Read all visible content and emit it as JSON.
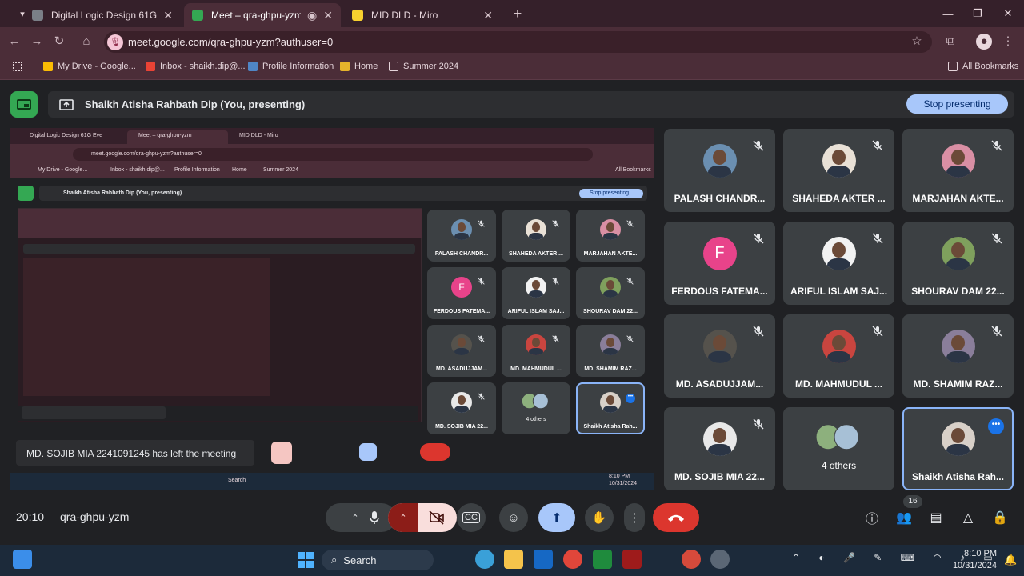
{
  "browser": {
    "tabs": [
      {
        "title": "Digital Logic Design 61G Eve",
        "color": "#7a7f87"
      },
      {
        "title": "Meet – qra-ghpu-yzm",
        "color": "#34a853"
      },
      {
        "title": "MID DLD - Miro",
        "color": "#f8d12f"
      }
    ],
    "new_tab": "+",
    "url": "meet.google.com/qra-ghpu-yzm?authuser=0",
    "bookmarks": [
      "My Drive - Google...",
      "Inbox - shaikh.dip@...",
      "Profile Information",
      "Home",
      "Summer 2024"
    ],
    "all_bookmarks": "All Bookmarks"
  },
  "meet": {
    "presenting_label": "Shaikh Atisha Rahbath Dip (You, presenting)",
    "stop_presenting": "Stop presenting",
    "participants": [
      {
        "name": "PALASH CHANDR...",
        "type": "photo",
        "color": "#6b8fb1"
      },
      {
        "name": "SHAHEDA AKTER ...",
        "type": "photo",
        "color": "#e9e1d6"
      },
      {
        "name": "MARJAHAN AKTE...",
        "type": "photo",
        "color": "#d98fa4"
      },
      {
        "name": "FERDOUS FATEMA...",
        "type": "letter",
        "letter": "F",
        "color": "#e8438a"
      },
      {
        "name": "ARIFUL ISLAM SAJ...",
        "type": "photo",
        "color": "#f2f2f2"
      },
      {
        "name": "SHOURAV DAM 22...",
        "type": "photo",
        "color": "#7fa05d"
      },
      {
        "name": "MD. ASADUJJAM...",
        "type": "photo",
        "color": "#55524c"
      },
      {
        "name": "MD. MAHMUDUL ...",
        "type": "photo",
        "color": "#c9453f"
      },
      {
        "name": "MD. SHAMIM RAZ...",
        "type": "photo",
        "color": "#8a7e9a"
      },
      {
        "name": "MD. SOJIB MIA 22...",
        "type": "photo",
        "color": "#e8e8e8"
      },
      {
        "name": "4 others",
        "type": "others",
        "color": "#8db07d"
      },
      {
        "name": "Shaikh Atisha Rah...",
        "type": "photo",
        "color": "#d8d0c8"
      }
    ],
    "time": "20:10",
    "meeting_code": "qra-ghpu-yzm",
    "participant_count": "16",
    "nested_toast": "MD. SOJIB MIA 2241091245 has left the meeting"
  },
  "taskbar": {
    "search": "Search",
    "time": "8:10 PM",
    "date": "10/31/2024"
  }
}
